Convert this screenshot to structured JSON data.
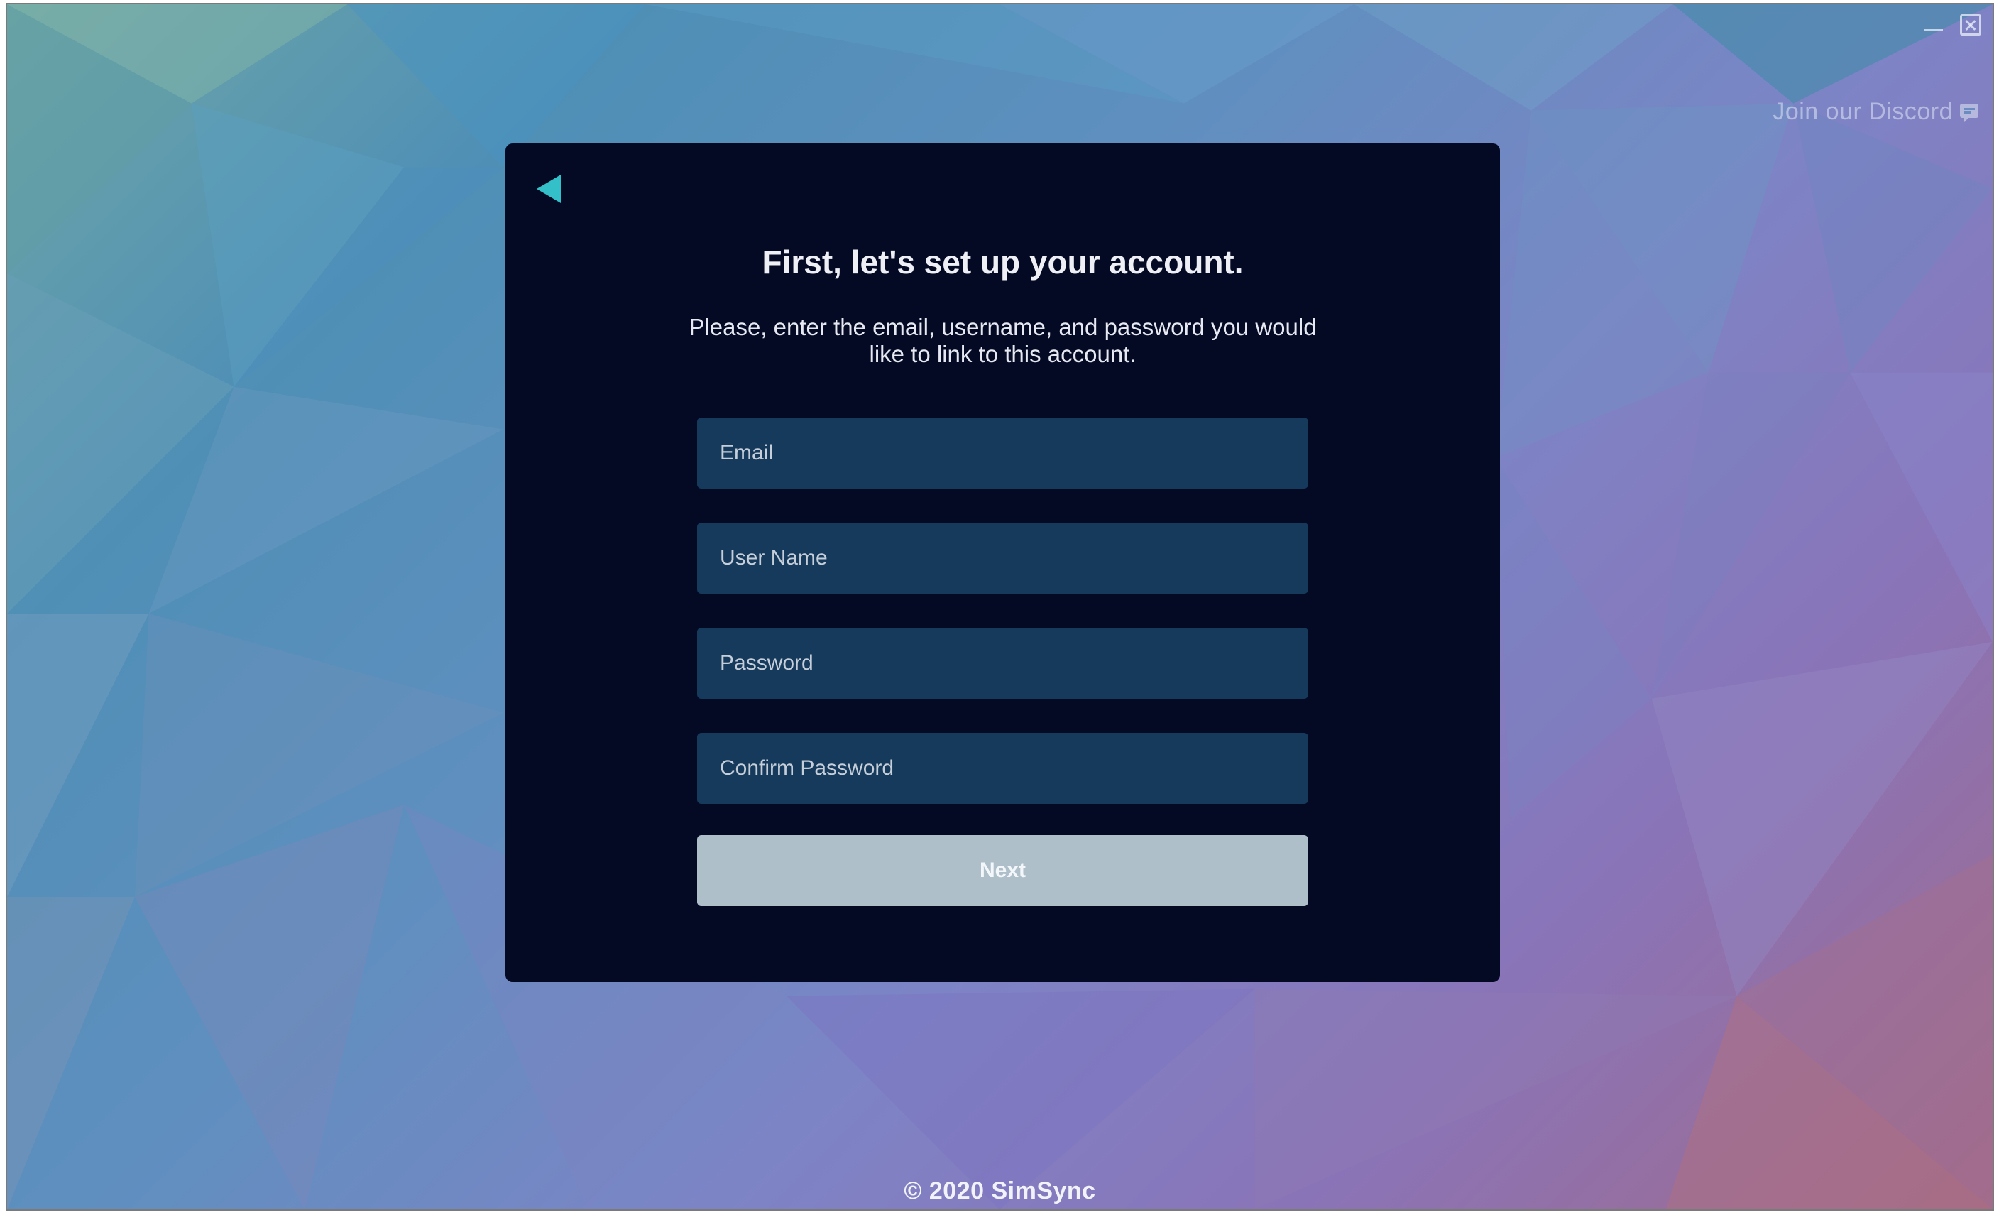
{
  "window": {
    "controls": {
      "minimize_icon": "minimize-icon",
      "close_icon": "close-icon"
    }
  },
  "header": {
    "discord_link": "Join our Discord",
    "discord_icon": "discord-chat-icon"
  },
  "card": {
    "back_icon": "back-arrow-icon",
    "title": "First, let's set up your account.",
    "subtitle": "Please, enter the email, username, and password you would like to link to this account.",
    "fields": {
      "email_placeholder": "Email",
      "username_placeholder": "User Name",
      "password_placeholder": "Password",
      "confirm_password_placeholder": "Confirm Password"
    },
    "next_label": "Next"
  },
  "footer": {
    "copyright": "© 2020 SimSync"
  },
  "colors": {
    "card_background": "#050a24",
    "field_background": "#163a5b",
    "button_background": "#aebfca",
    "accent_teal": "#33c0c8"
  }
}
